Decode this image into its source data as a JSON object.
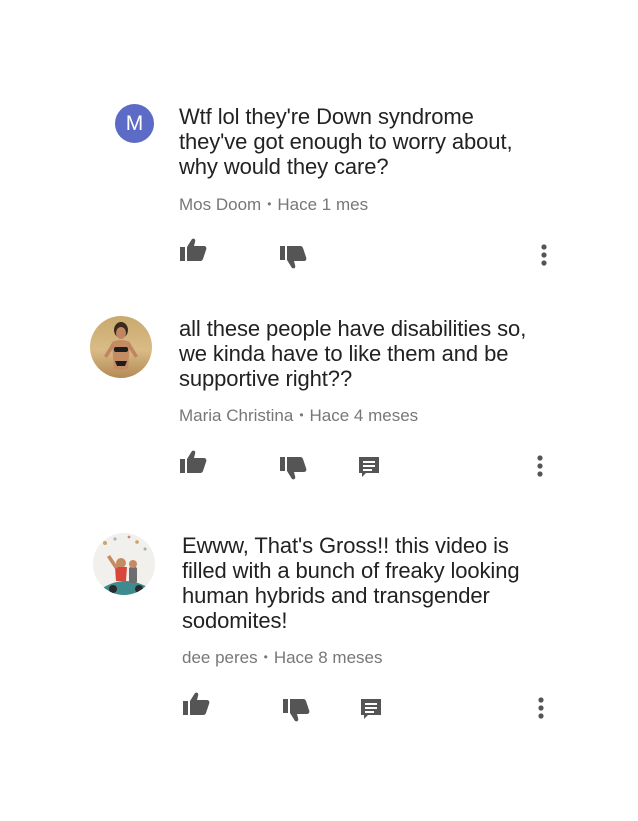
{
  "comments": [
    {
      "avatar_letter": "M",
      "text_lines": [
        "Wtf lol they're Down syndrome",
        "they've got enough to worry about,",
        "why would they care?"
      ],
      "author": "Mos Doom",
      "time": "Hace 1 mes",
      "has_reply": false
    },
    {
      "avatar_letter": "",
      "text_lines": [
        "all these people have disabilities so,",
        "we kinda have to like them and be",
        "supportive right??"
      ],
      "author": "Maria Christina",
      "time": "Hace 4 meses",
      "has_reply": true
    },
    {
      "avatar_letter": "",
      "text_lines": [
        "Ewww, That's Gross!! this video is",
        "filled with a bunch of freaky looking",
        "human hybrids and transgender",
        "sodomites!"
      ],
      "author": "dee peres",
      "time": "Hace 8 meses",
      "has_reply": true
    }
  ],
  "meta_separator": "•",
  "icons": {
    "like": "thumb-up-icon",
    "dislike": "thumb-down-icon",
    "reply": "reply-icon",
    "more": "more-vert-icon"
  },
  "colors": {
    "avatar_bg": "#5b6bc6",
    "text": "#222222",
    "meta": "#777777",
    "icon": "#555555"
  }
}
